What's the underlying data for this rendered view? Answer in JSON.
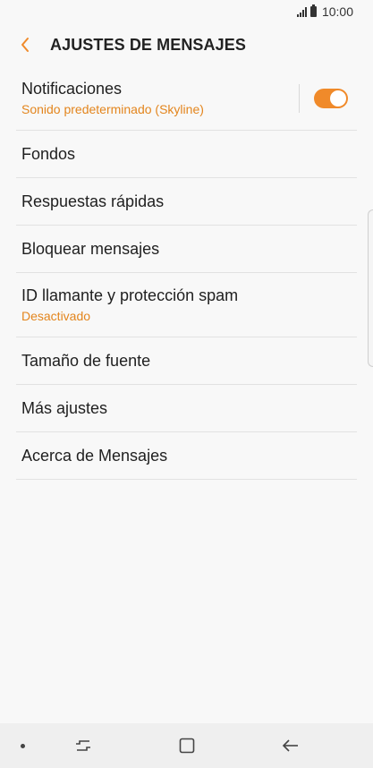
{
  "status": {
    "time": "10:00"
  },
  "header": {
    "title": "AJUSTES DE MENSAJES"
  },
  "items": [
    {
      "label": "Notificaciones",
      "sub": "Sonido predeterminado (Skyline)"
    },
    {
      "label": "Fondos"
    },
    {
      "label": "Respuestas rápidas"
    },
    {
      "label": "Bloquear mensajes"
    },
    {
      "label": "ID llamante y protección spam",
      "sub": "Desactivado"
    },
    {
      "label": "Tamaño de fuente"
    },
    {
      "label": "Más ajustes"
    },
    {
      "label": "Acerca de Mensajes"
    }
  ],
  "notifications_toggle": {
    "on": true
  },
  "colors": {
    "accent": "#f08a2a",
    "subtext": "#e3851d",
    "background": "#f8f8f8"
  },
  "icons": [
    "signal-icon",
    "battery-icon",
    "back-arrow-icon",
    "recents-icon",
    "home-icon",
    "back-icon"
  ]
}
